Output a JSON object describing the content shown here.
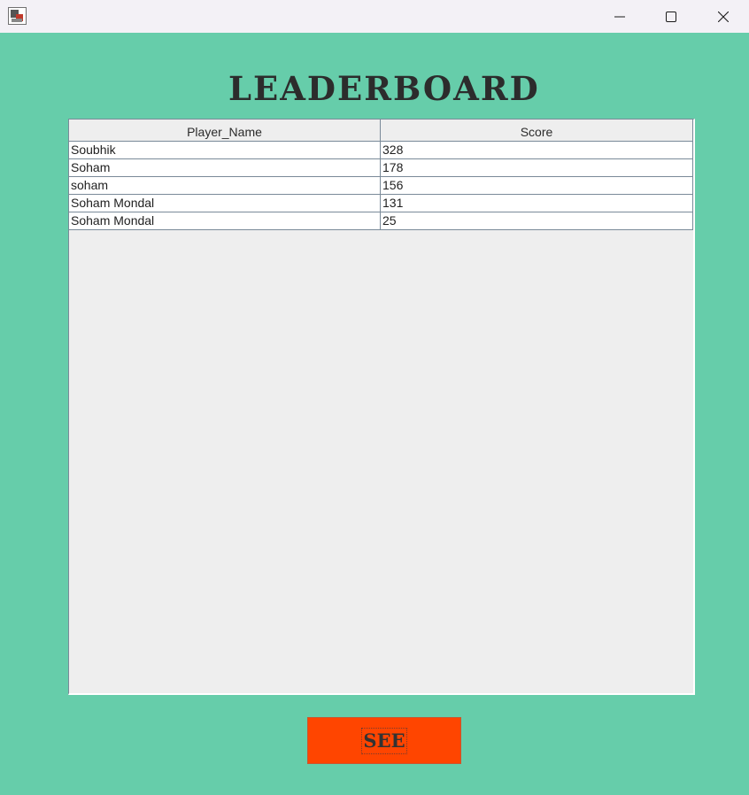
{
  "window": {
    "icon": "java-app-icon",
    "controls": [
      "minimize-icon",
      "maximize-icon",
      "close-icon"
    ]
  },
  "header": {
    "title": "LEADERBOARD"
  },
  "table": {
    "columns": [
      "Player_Name",
      "Score"
    ],
    "rows": [
      [
        "Soubhik",
        "328"
      ],
      [
        "Soham",
        "178"
      ],
      [
        "soham",
        "156"
      ],
      [
        "Soham Mondal",
        "131"
      ],
      [
        "Soham Mondal",
        "25"
      ]
    ]
  },
  "actions": {
    "see_label": "SEE"
  },
  "colors": {
    "background": "#66cdaa",
    "button": "#ff4500",
    "title_text": "#2c2c2c",
    "titlebar": "#f3f1f6"
  }
}
